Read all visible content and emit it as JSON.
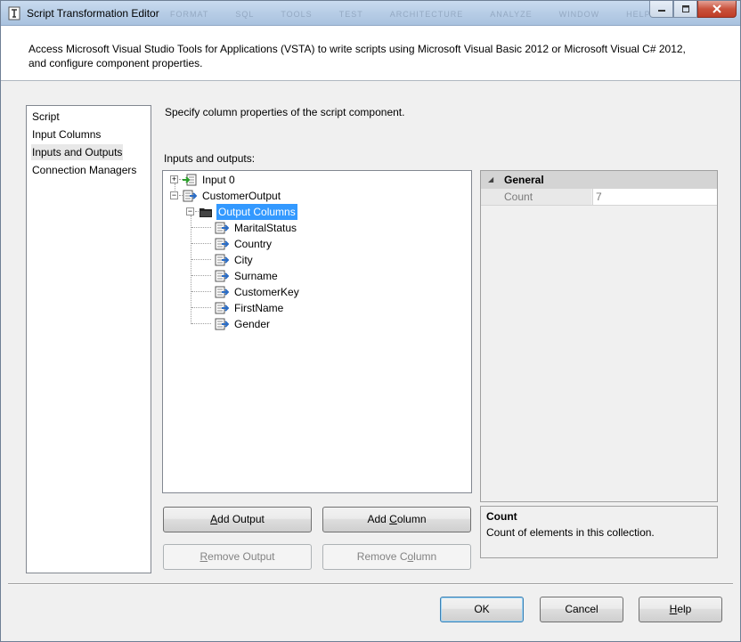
{
  "window": {
    "title": "Script Transformation Editor",
    "ghost_menu": [
      "FORMAT",
      "SQL",
      "TOOLS",
      "TEST",
      "ARCHITECTURE",
      "ANALYZE",
      "WINDOW",
      "HELP"
    ]
  },
  "header": {
    "description": "Access Microsoft Visual Studio Tools for Applications (VSTA) to write scripts using Microsoft Visual Basic 2012 or Microsoft Visual C# 2012, and configure component properties."
  },
  "nav": {
    "items": [
      {
        "label": "Script"
      },
      {
        "label": "Input Columns"
      },
      {
        "label": "Inputs and Outputs",
        "selected": true
      },
      {
        "label": "Connection Managers"
      }
    ]
  },
  "main": {
    "instruction": "Specify column properties of the script component.",
    "tree_label": "Inputs and outputs:",
    "tree": {
      "input": "Input 0",
      "output": "CustomerOutput",
      "output_columns": "Output Columns",
      "columns": [
        "MaritalStatus",
        "Country",
        "City",
        "Surname",
        "CustomerKey",
        "FirstName",
        "Gender"
      ]
    }
  },
  "properties": {
    "category": "General",
    "rows": [
      {
        "name": "Count",
        "value": "7"
      }
    ],
    "help_title": "Count",
    "help_text": "Count of elements in this collection."
  },
  "buttons": {
    "add_output": "Add Output",
    "add_column": "Add Column",
    "remove_output": "Remove Output",
    "remove_column": "Remove Column",
    "ok": "OK",
    "cancel": "Cancel",
    "help": "Help"
  },
  "colors": {
    "selection": "#3399ff",
    "window_bg": "#f0f0f0",
    "close_button": "#c9533d"
  }
}
